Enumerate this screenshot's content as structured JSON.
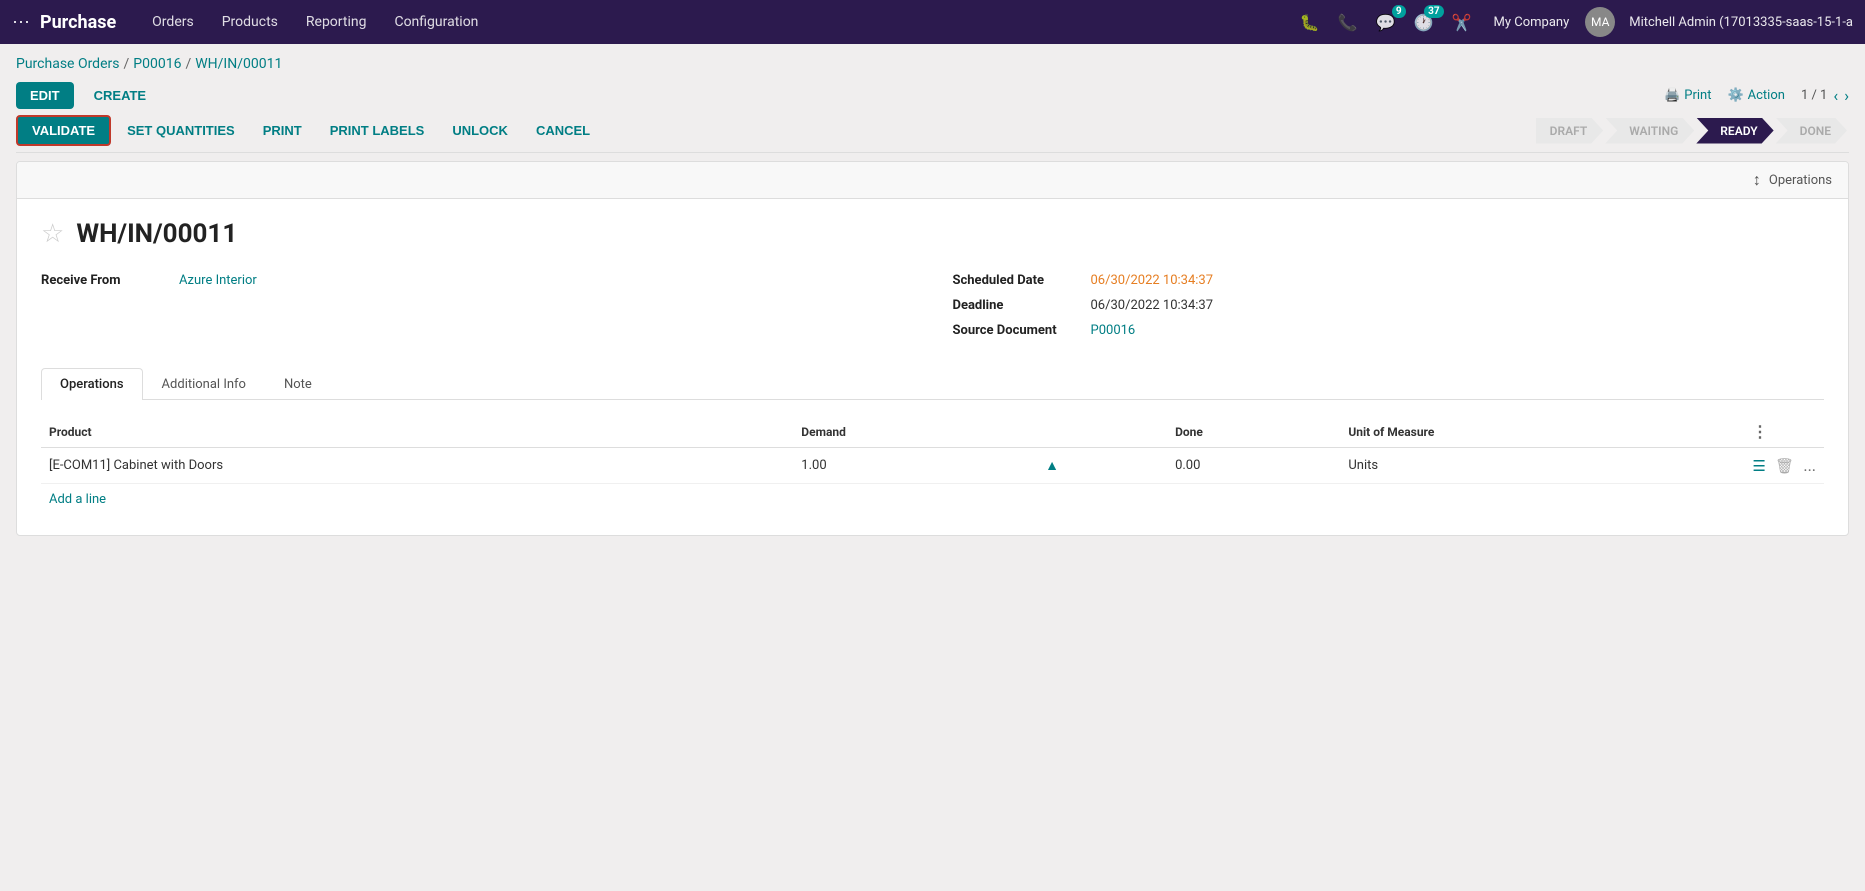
{
  "app": {
    "brand": "Purchase",
    "nav_items": [
      "Orders",
      "Products",
      "Reporting",
      "Configuration"
    ]
  },
  "nav_icons": {
    "bug_badge": null,
    "phone_badge": null,
    "chat_badge": "9",
    "clock_badge": "37",
    "scissors_badge": null,
    "company": "My Company",
    "user": "Mitchell Admin (17013335-saas-15-1-a"
  },
  "breadcrumb": {
    "parts": [
      "Purchase Orders",
      "P00016",
      "WH/IN/00011"
    ],
    "separator": "/"
  },
  "toolbar": {
    "edit_label": "EDIT",
    "create_label": "CREATE",
    "print_label": "Print",
    "action_label": "Action",
    "pagination": "1 / 1"
  },
  "action_bar": {
    "validate_label": "VALIDATE",
    "set_quantities_label": "SET QUANTITIES",
    "print_label": "PRINT",
    "print_labels_label": "PRINT LABELS",
    "unlock_label": "UNLOCK",
    "cancel_label": "CANCEL"
  },
  "status_steps": [
    {
      "label": "DRAFT",
      "state": "inactive"
    },
    {
      "label": "WAITING",
      "state": "inactive"
    },
    {
      "label": "READY",
      "state": "active"
    },
    {
      "label": "DONE",
      "state": "inactive"
    }
  ],
  "ops_sidebar": {
    "label": "Operations"
  },
  "document": {
    "title": "WH/IN/00011",
    "receive_from_label": "Receive From",
    "receive_from_value": "Azure Interior",
    "scheduled_date_label": "Scheduled Date",
    "scheduled_date_value": "06/30/2022 10:34:37",
    "deadline_label": "Deadline",
    "deadline_value": "06/30/2022 10:34:37",
    "source_doc_label": "Source Document",
    "source_doc_value": "P00016"
  },
  "tabs": [
    {
      "id": "operations",
      "label": "Operations",
      "active": true
    },
    {
      "id": "additional-info",
      "label": "Additional Info",
      "active": false
    },
    {
      "id": "note",
      "label": "Note",
      "active": false
    }
  ],
  "table": {
    "columns": [
      "Product",
      "Demand",
      "",
      "Done",
      "Unit of Measure",
      ""
    ],
    "rows": [
      {
        "product": "[E-COM11] Cabinet with Doors",
        "demand": "1.00",
        "done": "0.00",
        "unit": "Units"
      }
    ],
    "add_line_label": "Add a line"
  }
}
